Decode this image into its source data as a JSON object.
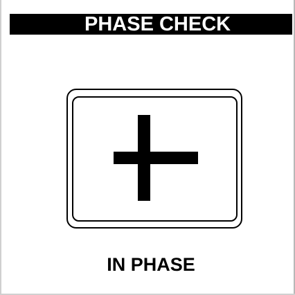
{
  "header": {
    "title": "PHASE CHECK"
  },
  "indicator": {
    "symbol": "plus",
    "symbol_icon": "plus-icon",
    "state_label": "IN PHASE"
  },
  "colors": {
    "background": "#ffffff",
    "title_bar": "#000000",
    "title_text": "#ffffff",
    "symbol": "#000000"
  }
}
